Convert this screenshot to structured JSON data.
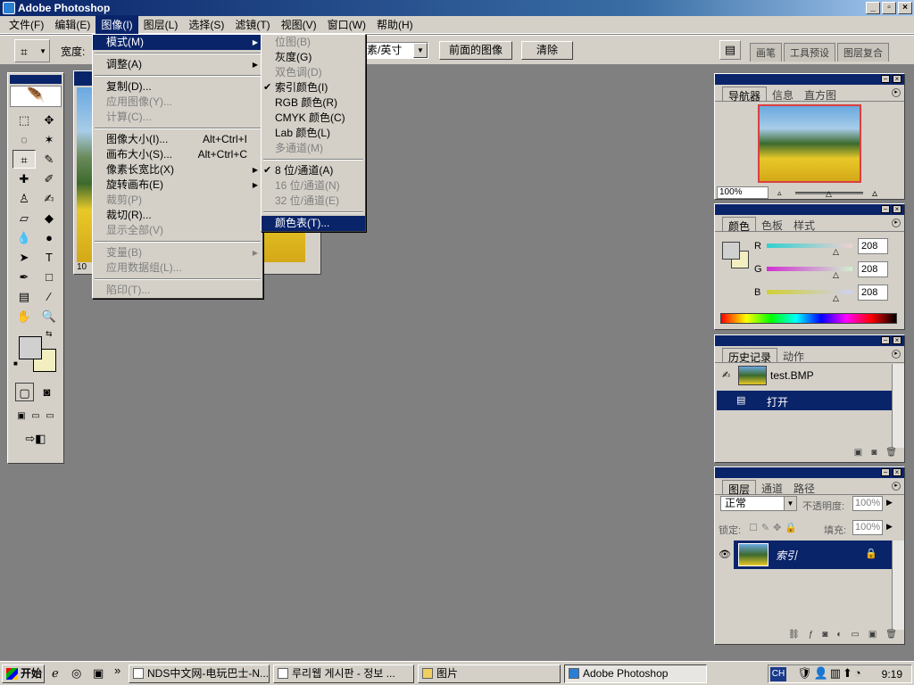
{
  "window": {
    "title": "Adobe Photoshop",
    "buttons": [
      "_",
      "▫",
      "×"
    ]
  },
  "menubar": [
    "文件(F)",
    "编辑(E)",
    "图像(I)",
    "图层(L)",
    "选择(S)",
    "滤镜(T)",
    "视图(V)",
    "窗口(W)",
    "帮助(H)"
  ],
  "options": {
    "width_label": "宽度:",
    "unit": "素/英寸",
    "front_image_btn": "前面的图像",
    "clear_btn": "清除",
    "well_tabs": [
      "画笔",
      "工具预设",
      "图层复合"
    ]
  },
  "image_menu": [
    {
      "label": "模式(M)",
      "sub": true,
      "hl": true
    },
    {
      "sep": true
    },
    {
      "label": "调整(A)",
      "sub": true
    },
    {
      "sep": true
    },
    {
      "label": "复制(D)..."
    },
    {
      "label": "应用图像(Y)...",
      "dis": true
    },
    {
      "label": "计算(C)...",
      "dis": true
    },
    {
      "sep": true
    },
    {
      "label": "图像大小(I)...",
      "shortcut": "Alt+Ctrl+I"
    },
    {
      "label": "画布大小(S)...",
      "shortcut": "Alt+Ctrl+C"
    },
    {
      "label": "像素长宽比(X)",
      "sub": true
    },
    {
      "label": "旋转画布(E)",
      "sub": true
    },
    {
      "label": "裁剪(P)",
      "dis": true
    },
    {
      "label": "裁切(R)..."
    },
    {
      "label": "显示全部(V)",
      "dis": true
    },
    {
      "sep": true
    },
    {
      "label": "变量(B)",
      "sub": true,
      "dis": true
    },
    {
      "label": "应用数据组(L)...",
      "dis": true
    },
    {
      "sep": true
    },
    {
      "label": "陷印(T)...",
      "dis": true
    }
  ],
  "mode_menu": [
    {
      "label": "位图(B)",
      "dis": true
    },
    {
      "label": "灰度(G)"
    },
    {
      "label": "双色调(D)",
      "dis": true
    },
    {
      "label": "索引颜色(I)",
      "check": true
    },
    {
      "label": "RGB 颜色(R)"
    },
    {
      "label": "CMYK 颜色(C)"
    },
    {
      "label": "Lab 颜色(L)"
    },
    {
      "label": "多通道(M)",
      "dis": true
    },
    {
      "sep": true
    },
    {
      "label": "8 位/通道(A)",
      "check": true
    },
    {
      "label": "16 位/通道(N)",
      "dis": true
    },
    {
      "label": "32 位/通道(E)",
      "dis": true
    },
    {
      "sep": true
    },
    {
      "label": "颜色表(T)...",
      "hl": true
    }
  ],
  "document": {
    "zoom": "10"
  },
  "navigator": {
    "tabs": [
      "导航器",
      "信息",
      "直方图"
    ],
    "zoom": "100%"
  },
  "color_panel": {
    "tabs": [
      "颜色",
      "色板",
      "样式"
    ],
    "channels": [
      {
        "name": "R",
        "value": "208",
        "gradient": "linear-gradient(90deg,#30d0d0,#f0d0d0)"
      },
      {
        "name": "G",
        "value": "208",
        "gradient": "linear-gradient(90deg,#d030d0,#d0f0d0)"
      },
      {
        "name": "B",
        "value": "208",
        "gradient": "linear-gradient(90deg,#d0d030,#d0d0f0)"
      }
    ],
    "fg": "#d0d0d0",
    "bg": "#f2eec0"
  },
  "history": {
    "tabs": [
      "历史记录",
      "动作"
    ],
    "items": [
      {
        "label": "test.BMP"
      },
      {
        "label": "打开"
      }
    ]
  },
  "layers": {
    "tabs": [
      "图层",
      "通道",
      "路径"
    ],
    "blend": "正常",
    "opacity_label": "不透明度:",
    "opacity": "100%",
    "lock_label": "锁定:",
    "fill_label": "填充:",
    "fill": "100%",
    "layer_name": "索引"
  },
  "taskbar": {
    "start": "开始",
    "tasks": [
      "NDS中文网-电玩巴士-N...",
      "루리웹 게시판 - 정보 ...",
      "图片",
      "Adobe Photoshop"
    ],
    "ime": "CH",
    "clock": "9:19"
  }
}
